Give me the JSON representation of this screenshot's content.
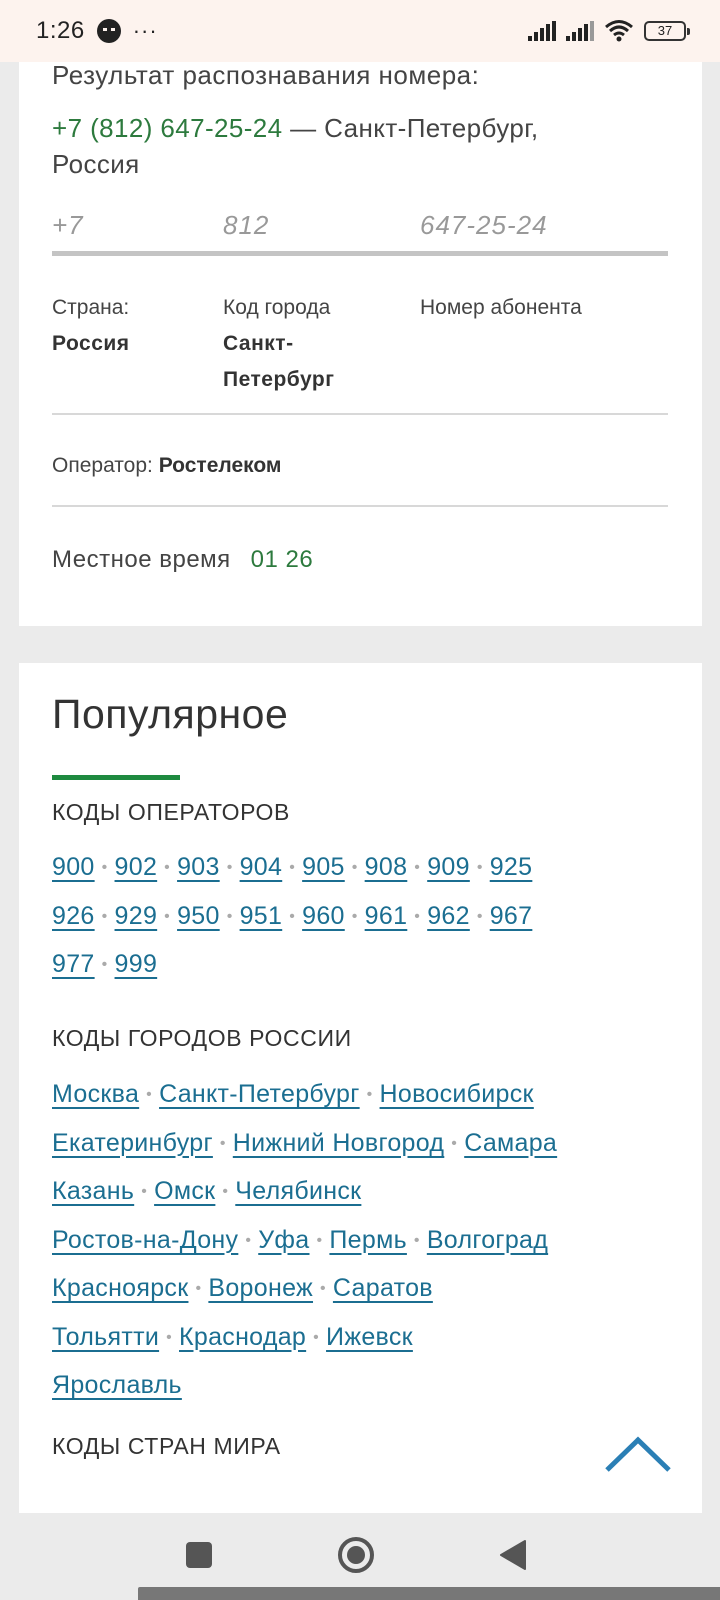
{
  "status_bar": {
    "time": "1:26",
    "dots": "···",
    "battery": "37"
  },
  "result": {
    "title": "Результат распознавания номера:",
    "phone": "+7 (812) 647-25-24",
    "location": " — Санкт-Петербург, Россия",
    "part_country": "+7",
    "part_city": "812",
    "part_subscriber": "647-25-24",
    "country_label": "Страна:",
    "country_value": "Россия",
    "city_label": "Код города",
    "city_value_1": "Санкт-",
    "city_value_2": "Петербург",
    "subscriber_label": "Номер абонента",
    "operator_label": "Оператор: ",
    "operator_value": "Ростелеком",
    "localtime_label": "Местное время",
    "localtime_value": "01 26"
  },
  "popular": {
    "title": "Популярное",
    "operators_heading": "КОДЫ ОПЕРАТОРОВ",
    "operator_codes": [
      [
        "900",
        "902",
        "903",
        "904",
        "905",
        "908",
        "909",
        "925"
      ],
      [
        "926",
        "929",
        "950",
        "951",
        "960",
        "961",
        "962",
        "967"
      ],
      [
        "977",
        "999"
      ]
    ],
    "cities_heading": "КОДЫ ГОРОДОВ РОССИИ",
    "cities": [
      [
        "Москва",
        "Санкт-Петербург",
        "Новосибирск"
      ],
      [
        "Екатеринбург",
        "Нижний Новгород",
        "Самара"
      ],
      [
        "Казань",
        "Омск",
        "Челябинск"
      ],
      [
        "Ростов-на-Дону",
        "Уфа",
        "Пермь",
        "Волгоград"
      ],
      [
        "Красноярск",
        "Воронеж",
        "Саратов"
      ],
      [
        "Тольятти",
        "Краснодар",
        "Ижевск"
      ],
      [
        "Ярославль"
      ]
    ],
    "countries_heading": "КОДЫ СТРАН МИРА"
  },
  "colors": {
    "accent_green": "#2d7a3e",
    "link_blue": "#1b6e91",
    "underline_green": "#1e8a3f",
    "scroll_top_blue": "#2b7fb5"
  },
  "icons": {
    "scroll_top": "chevron-up-icon",
    "nav_recents": "square-icon",
    "nav_home": "circle-icon",
    "nav_back": "triangle-back-icon"
  }
}
